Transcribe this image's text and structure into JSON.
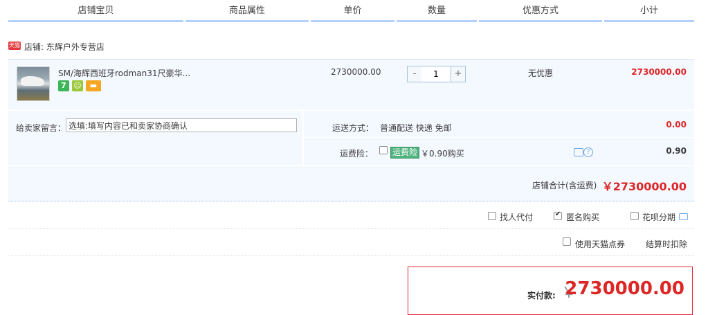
{
  "header": {
    "columns": [
      "店铺宝贝",
      "商品属性",
      "单价",
      "数量",
      "优惠方式",
      "小计"
    ]
  },
  "shop": {
    "badge": "天猫",
    "label": "店铺: 东辉户外专营店"
  },
  "item": {
    "title": "SM/海辉西班牙rodman31尺豪华...",
    "unit_price": "2730000.00",
    "quantity": "1",
    "decrement": "-",
    "increment": "+",
    "promotion": "无优惠",
    "subtotal": "2730000.00",
    "icons": [
      "seven-day-return-icon",
      "guarantee-icon",
      "credit-card-icon"
    ]
  },
  "message": {
    "label": "给卖家留言：",
    "placeholder": "选填:填写内容已和卖家协商确认"
  },
  "shipping": {
    "label": "运送方式：",
    "method": "普通配送 快递 免邮",
    "fee": "0.00"
  },
  "insurance": {
    "label": "运费险：",
    "tag": "运费险",
    "buy_text": "￥0.90购买",
    "fee": "0.90"
  },
  "shop_total": {
    "label": "店铺合计(含运费)",
    "amount": "￥2730000.00"
  },
  "options": {
    "proxy_pay": {
      "label": "找人代付",
      "checked": false
    },
    "anonymous": {
      "label": "匿名购买",
      "checked": true
    },
    "huabei": {
      "label": "花呗分期",
      "checked": false
    },
    "tmall_points": {
      "label": "使用天猫点券",
      "checked": false
    },
    "deduct_note": "结算时扣除"
  },
  "payment": {
    "label": "实付款:",
    "currency": "￥",
    "amount": "2730000.00"
  },
  "colors": {
    "accent_red": "#dd2727",
    "header_bar": "#b2d1ff",
    "row_bg": "#f4f8ff"
  }
}
